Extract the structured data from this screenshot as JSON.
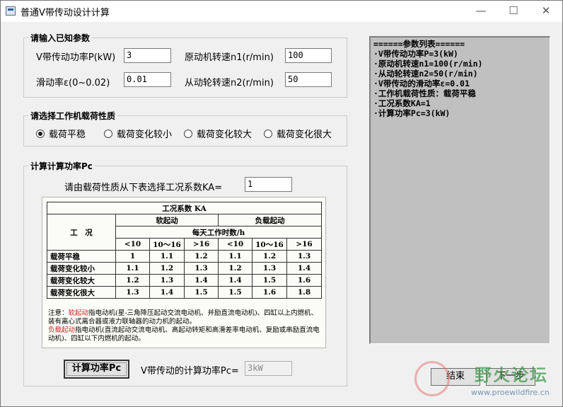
{
  "window": {
    "title": "普通V带传动设计计算",
    "minimize_glyph": "—",
    "maximize_glyph": "☐",
    "close_glyph": "✕"
  },
  "known_params": {
    "title": "请输入已知参数",
    "power_label": "V带传动功率P(kW)",
    "power_value": "3",
    "n1_label": "原动机转速n1(r/min)",
    "n1_value": "100",
    "slip_label": "滑动率ε(0~0.02)",
    "slip_value": "0.01",
    "n2_label": "从动轮转速n2(r/min)",
    "n2_value": "50"
  },
  "load_nature": {
    "title": "请选择工作机载荷性质",
    "options": [
      "载荷平稳",
      "载荷变化较小",
      "载荷变化较大",
      "载荷变化很大"
    ],
    "selected_index": 0
  },
  "pc_calc": {
    "title": "计算计算功率Pc",
    "ka_prompt": "请由载荷性质从下表选择工况系数KA=",
    "ka_value": "1",
    "calc_button": "计算功率Pc",
    "result_label": "V带传动的计算功率Pc=",
    "result_value": "3kW"
  },
  "ka_table": {
    "caption": "工况系数 KA",
    "condition_header": "工　况",
    "soft_start": "软起动",
    "load_start": "负载起动",
    "hours_header": "每天工作时数/h",
    "hours": [
      "<10",
      "10～16",
      ">16",
      "<10",
      "10～16",
      ">16"
    ],
    "rows": [
      {
        "name": "载荷平稳",
        "values": [
          "1",
          "1.1",
          "1.2",
          "1.1",
          "1.2",
          "1.3"
        ]
      },
      {
        "name": "载荷变化较小",
        "values": [
          "1.1",
          "1.2",
          "1.3",
          "1.2",
          "1.3",
          "1.4"
        ]
      },
      {
        "name": "载荷变化较大",
        "values": [
          "1.2",
          "1.3",
          "1.4",
          "1.4",
          "1.5",
          "1.6"
        ]
      },
      {
        "name": "载荷变化很大",
        "values": [
          "1.3",
          "1.4",
          "1.5",
          "1.5",
          "1.6",
          "1.8"
        ]
      }
    ],
    "note_prefix": "注意：",
    "note_soft_term": "软起动",
    "note_soft_text": "指电动机(星-三角降压起动交流电动机、并励直流电动机)、四缸以上内燃机、装有离心式离合器或液力联轴器的动力机的起动。",
    "note_load_term": "负载起动",
    "note_load_text": "指电动机(直流起动交流电动机、高起动转矩和高滑差率电动机、复励或串励直流电动机)、四缸以下内燃机的起动。"
  },
  "param_list": {
    "lines": [
      "======参数列表======",
      "·V带传动功率P=3(kW)",
      "·原动机转速n1=100(r/min)",
      "·从动轮转速n2=50(r/min)",
      "·V带传动的滑动率ε=0.01",
      "·工作机载荷性质：载荷平稳",
      "·工况系数KA=1",
      "·计算功率Pc=3(kW)"
    ]
  },
  "footer": {
    "end_button": "结束",
    "next_button": "下一步"
  },
  "watermark": {
    "cn": "野火论坛",
    "url": "www.proewildfire.cn"
  }
}
